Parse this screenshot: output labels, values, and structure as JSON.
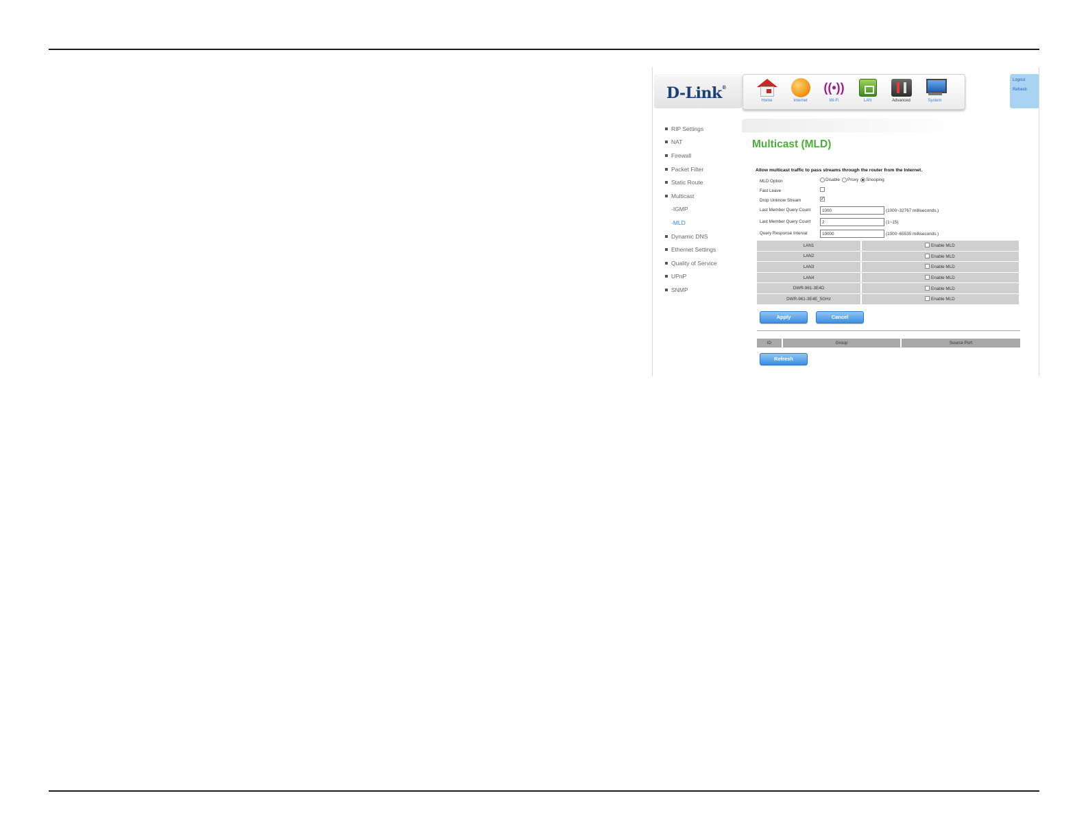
{
  "header": {
    "logo_text": "D-Link",
    "logo_mark": "®",
    "nav": [
      {
        "label": "Home",
        "icon": "home-icon"
      },
      {
        "label": "Internet",
        "icon": "globe-icon"
      },
      {
        "label": "Wi-Fi",
        "icon": "wifi-icon"
      },
      {
        "label": "LAN",
        "icon": "lan-icon"
      },
      {
        "label": "Advanced",
        "icon": "advanced-icon"
      },
      {
        "label": "System",
        "icon": "monitor-icon"
      }
    ],
    "active_nav": "Advanced",
    "links": {
      "logout": "Logout",
      "refresh": "Refresh"
    }
  },
  "sidebar": {
    "items": [
      {
        "label": "RIP Settings"
      },
      {
        "label": "NAT"
      },
      {
        "label": "Firewall"
      },
      {
        "label": "Packet Filter"
      },
      {
        "label": "Static Route"
      },
      {
        "label": "Multicast"
      },
      {
        "label": "-IGMP"
      },
      {
        "label": "-MLD"
      },
      {
        "label": "Dynamic DNS"
      },
      {
        "label": "Ethernet Settings"
      },
      {
        "label": "Quality of Service"
      },
      {
        "label": "UPnP"
      },
      {
        "label": "SNMP"
      }
    ],
    "active": "-MLD"
  },
  "page": {
    "title": "Multicast (MLD)",
    "intro": "Allow multicast traffic to pass streams through the router from the Internet."
  },
  "form": {
    "mld_option": {
      "label": "MLD Option",
      "options": [
        "Disable",
        "Proxy",
        "Snooping"
      ],
      "selected": "Snooping"
    },
    "fast_leave": {
      "label": "Fast Leave",
      "checked": false
    },
    "drop_unknown": {
      "label": "Drop Unknow Stream",
      "checked": true
    },
    "last_member_query_interval": {
      "label": "Last Member Query Count",
      "value": "1000",
      "hint": "(1000~32767 milliseconds.)"
    },
    "last_member_query_count": {
      "label": "Last Member Query Count",
      "value": "2",
      "hint": "(1~15)"
    },
    "query_response_interval": {
      "label": "Query Response Interval",
      "value": "10000",
      "hint": "(1000~65535 milliseconds.)"
    }
  },
  "interfaces": {
    "option_label": "Enable MLD",
    "rows": [
      {
        "name": "LAN1",
        "enabled": false
      },
      {
        "name": "LAN2",
        "enabled": false
      },
      {
        "name": "LAN3",
        "enabled": false
      },
      {
        "name": "LAN4",
        "enabled": false
      },
      {
        "name": "DWR-961-3E4D",
        "enabled": false
      },
      {
        "name": "DWR-961-3E4E_5GHz",
        "enabled": false
      }
    ]
  },
  "buttons": {
    "apply": "Apply",
    "cancel": "Cancel",
    "refresh": "Refresh"
  },
  "group_table": {
    "headers": [
      "ID",
      "Group",
      "Source Port"
    ]
  },
  "colors": {
    "title": "#4cae3a",
    "link": "#2b8ae5",
    "button": "#3d8ee0"
  }
}
